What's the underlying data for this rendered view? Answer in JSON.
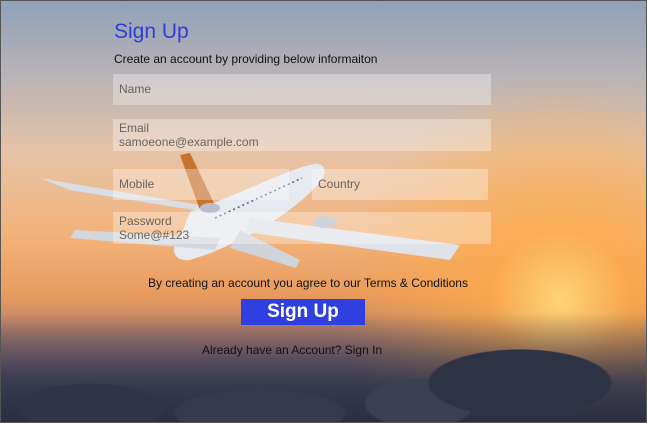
{
  "form": {
    "title": "Sign Up",
    "subtitle": "Create an account by providing below informaiton",
    "fields": {
      "name": {
        "placeholder": "Name"
      },
      "email": {
        "label": "Email",
        "placeholder": "samoeone@example.com"
      },
      "mobile": {
        "placeholder": "Mobile"
      },
      "country": {
        "placeholder": "Country"
      },
      "password": {
        "label": "Password",
        "placeholder": "Some@#123"
      }
    },
    "terms_text": "By creating an account you agree to our Terms & Conditions",
    "submit_label": "Sign Up",
    "signin_text": "Already have an Account? Sign In"
  }
}
